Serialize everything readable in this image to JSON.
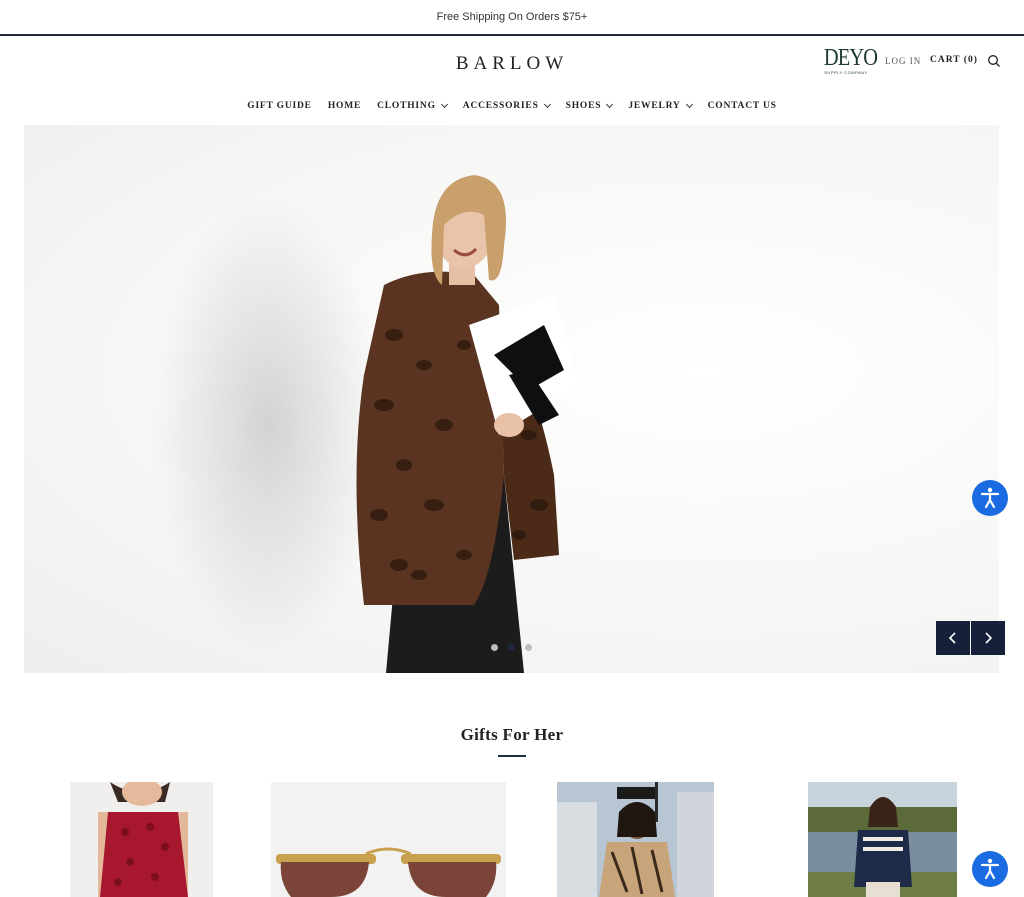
{
  "announcement": "Free Shipping On Orders $75+",
  "header": {
    "logo": "BARLOW",
    "partner_logo": {
      "main": "DEYO",
      "sub": "SUPPLY COMPANY"
    },
    "login_label": "LOG IN",
    "cart_label": "CART (0)"
  },
  "nav": {
    "items": [
      {
        "label": "GIFT GUIDE",
        "dropdown": false
      },
      {
        "label": "HOME",
        "dropdown": false
      },
      {
        "label": "CLOTHING",
        "dropdown": true
      },
      {
        "label": "ACCESSORIES",
        "dropdown": true
      },
      {
        "label": "SHOES",
        "dropdown": true
      },
      {
        "label": "JEWELRY",
        "dropdown": true
      },
      {
        "label": "CONTACT US",
        "dropdown": false
      }
    ]
  },
  "slideshow": {
    "slide_count": 3,
    "active_slide": 2
  },
  "section": {
    "title": "Gifts For Her"
  },
  "colors": {
    "accent": "#1f2a3d",
    "accessibility": "#1a6ae2",
    "deyo_green": "#1d3a2e"
  },
  "icons": [
    "search-icon",
    "chevron-down-icon",
    "chevron-left-icon",
    "chevron-right-icon",
    "accessibility-icon"
  ]
}
